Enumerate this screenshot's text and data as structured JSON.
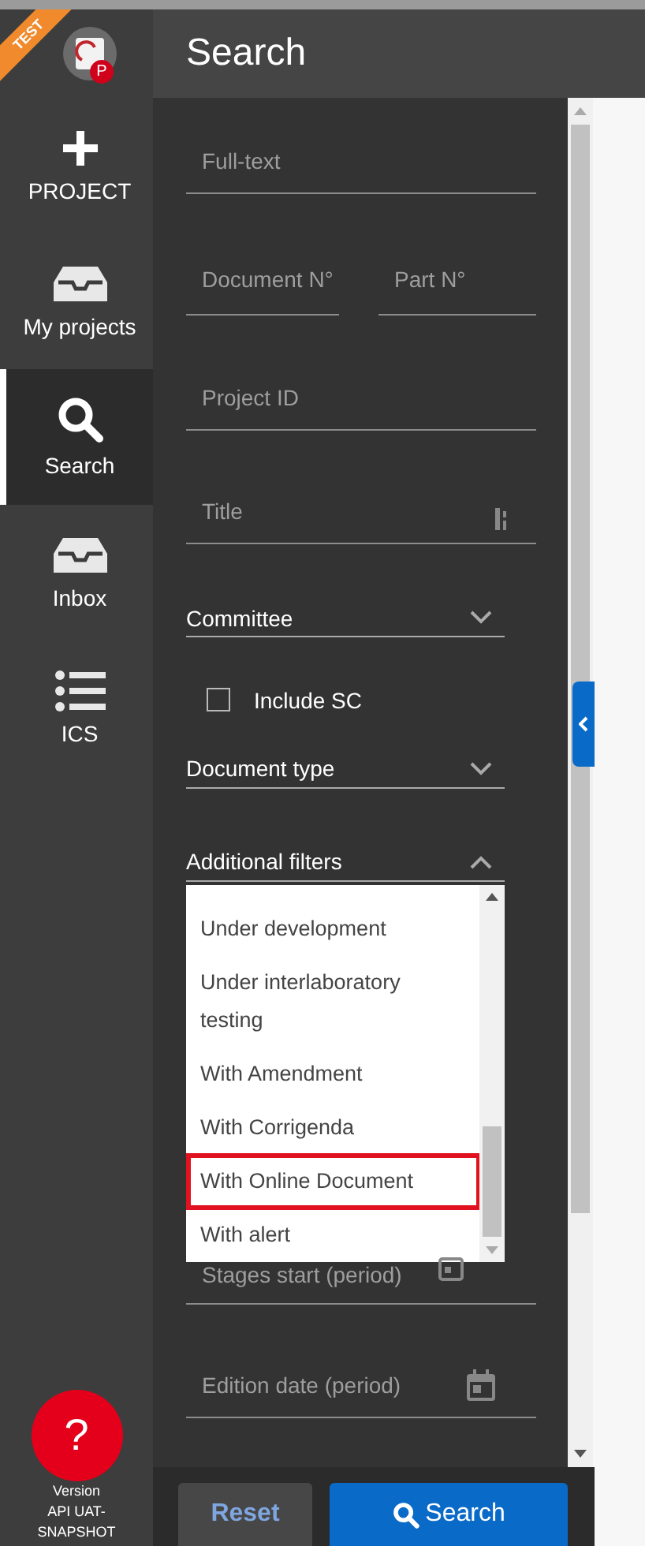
{
  "logo": {
    "ribbon": "TEST",
    "badge": "P"
  },
  "nav": [
    {
      "kind": "plus",
      "label": "PROJECT",
      "selected": false
    },
    {
      "kind": "tray",
      "label": "My projects",
      "selected": false
    },
    {
      "kind": "search",
      "label": "Search",
      "selected": true
    },
    {
      "kind": "tray",
      "label": "Inbox",
      "selected": false
    },
    {
      "kind": "list",
      "label": "ICS",
      "selected": false
    }
  ],
  "help": {
    "label": "?"
  },
  "version": [
    "Version",
    "API UAT-",
    "SNAPSHOT"
  ],
  "header": {
    "title": "Search"
  },
  "form": {
    "full_text": {
      "placeholder": "Full-text"
    },
    "document_no": {
      "placeholder": "Document N°"
    },
    "part_no": {
      "placeholder": "Part N°"
    },
    "project_id": {
      "placeholder": "Project ID"
    },
    "title": {
      "placeholder": "Title"
    },
    "committee": {
      "label": "Committee",
      "expanded": false
    },
    "include_sc": {
      "label": "Include SC",
      "checked": false
    },
    "document_type": {
      "label": "Document type",
      "expanded": false
    },
    "additional_filters": {
      "label": "Additional filters",
      "expanded": true,
      "options": [
        {
          "label": "Under development",
          "highlighted": false
        },
        {
          "label": "Under interlaboratory testing",
          "highlighted": false
        },
        {
          "label": "With Amendment",
          "highlighted": false
        },
        {
          "label": "With Corrigenda",
          "highlighted": false
        },
        {
          "label": "With Online Document",
          "highlighted": true
        },
        {
          "label": "With alert",
          "highlighted": false
        }
      ]
    },
    "stages_start": {
      "placeholder": "Stages start (period)"
    },
    "edition_date": {
      "placeholder": "Edition date (period)"
    }
  },
  "buttons": {
    "reset": "Reset",
    "search": "Search"
  }
}
